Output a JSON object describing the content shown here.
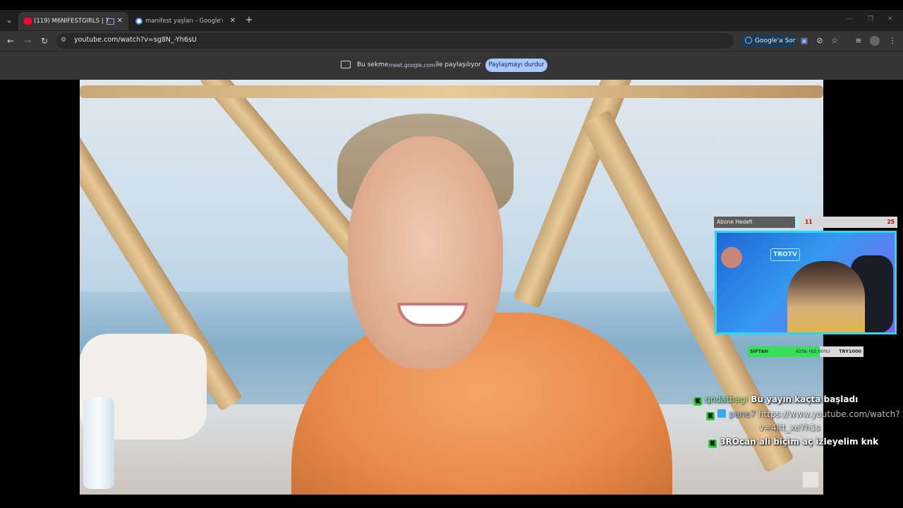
{
  "browser": {
    "tabs": [
      {
        "title": "(119) M6NIFESTGIRLS | 7. B",
        "active": true
      },
      {
        "title": "manifest yaşları - Google'da Ar",
        "active": false
      }
    ],
    "url": "youtube.com/watch?v=sg8N_-Yh6sU",
    "ask_google": "Google'a Sor"
  },
  "share_bar": {
    "text_before": "Bu sekme",
    "host": "meet.google.com",
    "text_after": "ile paylaşılıyor",
    "stop_button": "Paylaşmayı durdur"
  },
  "stream_overlay": {
    "sub_goal": {
      "label": "Abone Hedefi",
      "current": "11",
      "target": "25"
    },
    "donation_goal": {
      "label": "SİFTAH",
      "progress_text": "620₺ (62.00%)",
      "target": "TRY1000",
      "progress": 0.62
    },
    "webcam_sign": "TROTV",
    "chat": [
      {
        "user": "qndatbagi",
        "message": "Bu yayın kaçta başladı"
      },
      {
        "user": "pane7",
        "message": "https://www.youtube.com/watch?",
        "message_cont": "v=4ltt_xeYh1s"
      },
      {
        "user": "3ROcan",
        "message": "ali biçim aç izleyelim knk"
      }
    ]
  },
  "icons": {
    "kick": "K",
    "colors": {
      "kick_green": "#2fdc40",
      "accent_blue": "#a8c7fa"
    }
  }
}
